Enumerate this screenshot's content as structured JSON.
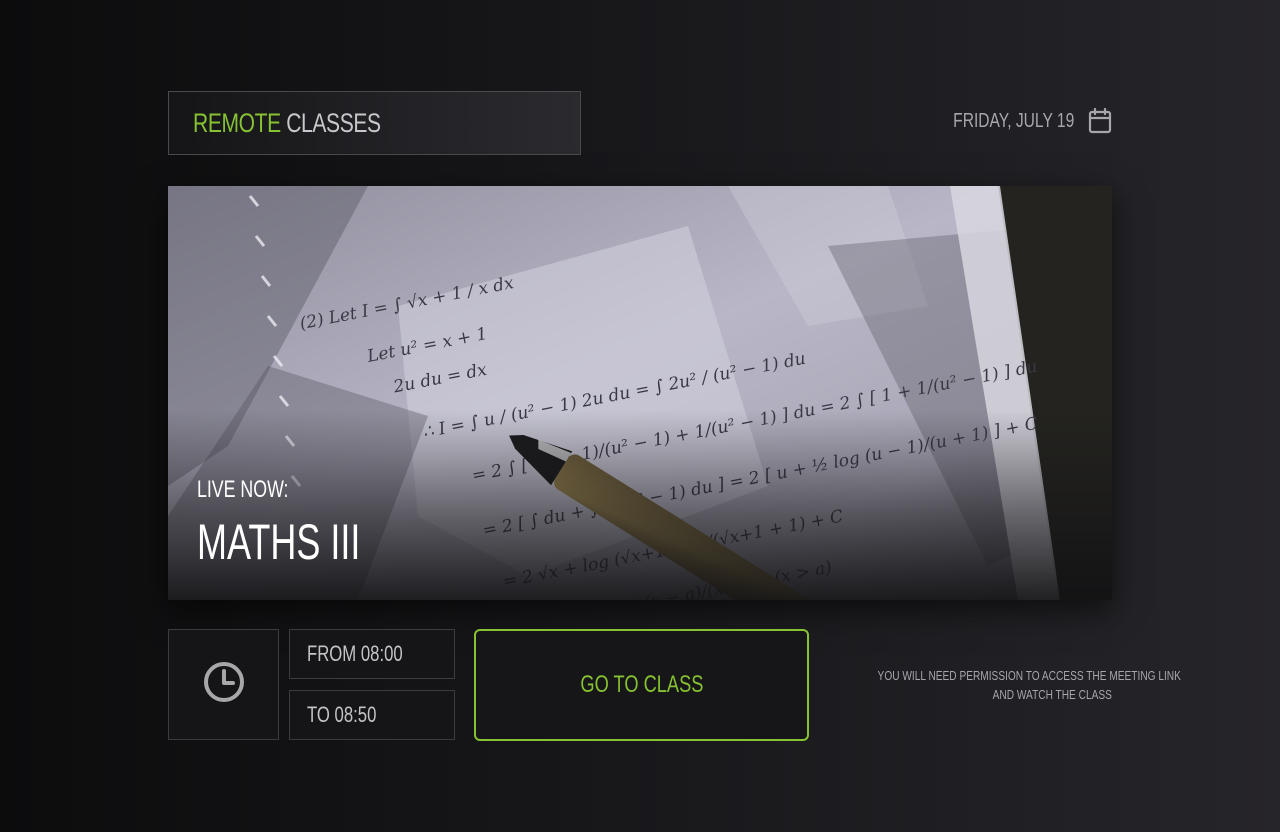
{
  "header": {
    "brand_accent": "REMOTE",
    "brand_rest": "CLASSES",
    "date": "FRIDAY, JULY 19"
  },
  "hero": {
    "live_label": "LIVE NOW:",
    "class_name": "MATHS III"
  },
  "schedule": {
    "from": "FROM 08:00",
    "to": "TO 08:50"
  },
  "actions": {
    "go_to_class": "GO TO CLASS"
  },
  "notice": {
    "line1": "YOU WILL NEED PERMISSION TO ACCESS THE MEETING LINK",
    "line2": "AND WATCH THE CLASS"
  },
  "icons": {
    "calendar": "calendar-icon",
    "clock": "clock-icon"
  },
  "colors": {
    "accent": "#86c232",
    "muted_text": "#a6a6ab",
    "panel": "#151517"
  }
}
